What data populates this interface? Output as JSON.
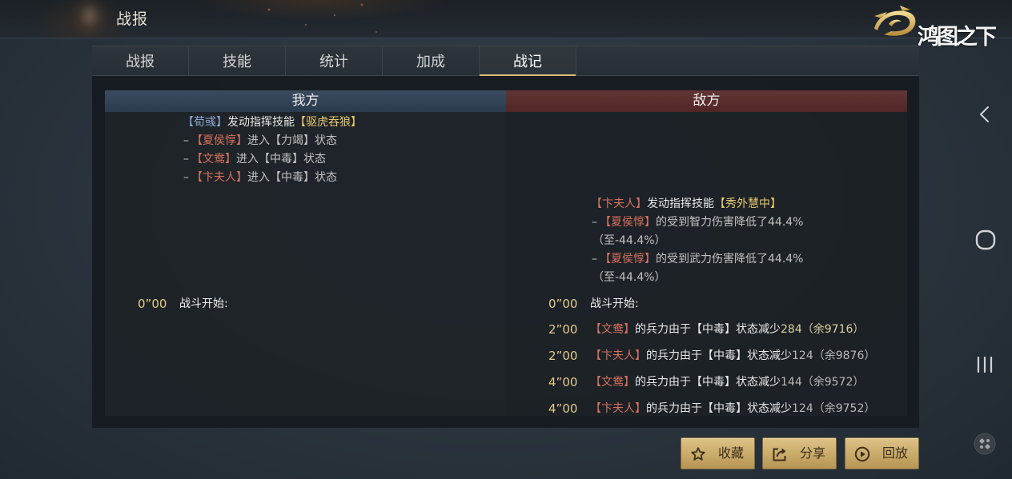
{
  "header": {
    "title": "战报",
    "logo_text": "鸿图之下"
  },
  "tabs": [
    {
      "label": "战报",
      "active": false
    },
    {
      "label": "技能",
      "active": false
    },
    {
      "label": "统计",
      "active": false
    },
    {
      "label": "加成",
      "active": false
    },
    {
      "label": "战记",
      "active": true
    }
  ],
  "my_side": {
    "label": "我方",
    "skill_cast": {
      "caster": "【荀彧】",
      "action": "发动指挥技能",
      "skill": "【驱虎吞狼】"
    },
    "effects": [
      {
        "prefix": "–",
        "target": "【夏侯惇】",
        "text": "进入【力竭】状态"
      },
      {
        "prefix": "–",
        "target": "【文鸯】",
        "text": "进入【中毒】状态"
      },
      {
        "prefix": "–",
        "target": "【卞夫人】",
        "text": "进入【中毒】状态"
      }
    ],
    "battle_start": {
      "time": "0”00",
      "text": "战斗开始:"
    }
  },
  "enemy_side": {
    "label": "敌方",
    "skill_cast": {
      "caster": "【卞夫人】",
      "action": "发动指挥技能",
      "skill": "【秀外慧中】"
    },
    "effects": [
      {
        "prefix": "–",
        "target": "【夏侯惇】",
        "text": "的受到智力伤害降低了44.4%",
        "detail": "（至-44.4%）"
      },
      {
        "prefix": "–",
        "target": "【夏侯惇】",
        "text": "的受到武力伤害降低了44.4%",
        "detail": "（至-44.4%）"
      }
    ],
    "battle_start": {
      "time": "0”00",
      "text": "战斗开始:"
    },
    "events": [
      {
        "time": "2”00",
        "target": "【文鸯】",
        "text": "的兵力由于【中毒】状态减少",
        "change": "284（余9716）",
        "change_color": "#dcd09e"
      },
      {
        "time": "2”00",
        "target": "【卞夫人】",
        "text": "的兵力由于【中毒】状态减少",
        "change": "124（余9876）",
        "change_color": "#b8b8b8"
      },
      {
        "time": "4”00",
        "target": "【文鸯】",
        "text": "的兵力由于【中毒】状态减少",
        "change": "144（余9572）",
        "change_color": "#b8b8b8"
      },
      {
        "time": "4”00",
        "target": "【卞夫人】",
        "text": "的兵力由于【中毒】状态减少",
        "change": "124（余9752）",
        "change_color": "#b8b8b8"
      }
    ]
  },
  "actions": {
    "favorite": "收藏",
    "share": "分享",
    "replay": "回放"
  },
  "icons": {
    "logo": "dragon-emblem-icon",
    "favorite": "star-icon",
    "share": "share-icon",
    "replay": "play-circle-icon",
    "nav_back": "chevron-left-icon",
    "nav_home": "home-circle-icon",
    "nav_recent": "recent-apps-icon",
    "assistant": "game-assistant-icon"
  },
  "colors": {
    "gold_accent": "#d9bc78",
    "my_hero": "#8ea6d4",
    "enemy_hero": "#d9705f",
    "skill_name": "#e8c96e",
    "timestamp": "#e3ca8c",
    "my_side_header": "#2f4056",
    "enemy_side_header": "#5a2a2a",
    "text_main": "#e8e8e8",
    "text_muted": "#c2c2c2",
    "button_text": "#3b2f1c"
  }
}
